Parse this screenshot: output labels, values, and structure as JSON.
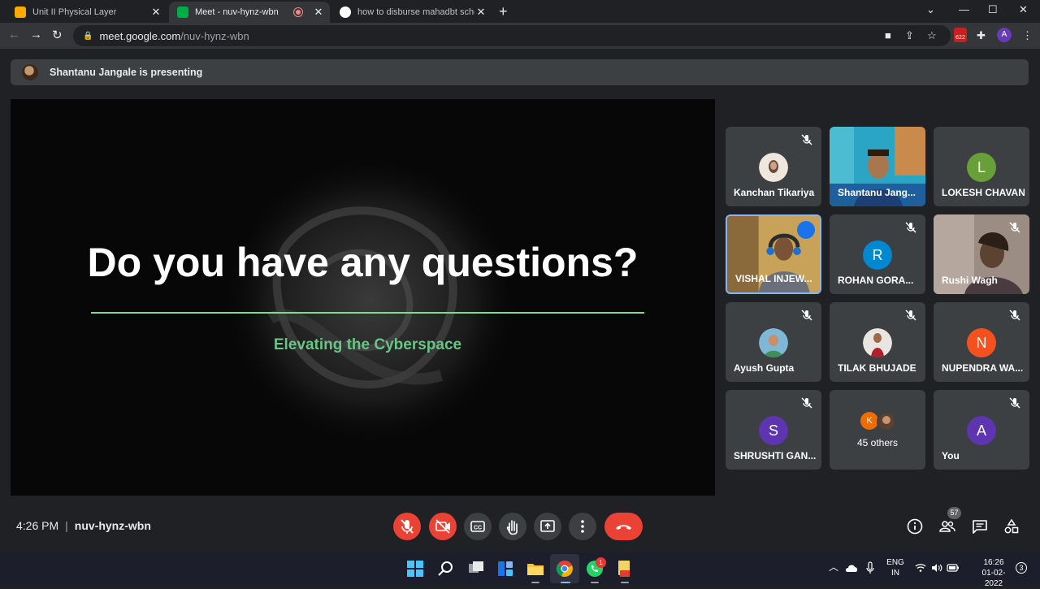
{
  "browser": {
    "tabs": [
      {
        "title": "Unit II Physical Layer",
        "active": false,
        "favicon_color": "#f9ab00"
      },
      {
        "title": "Meet - nuv-hynz-wbn",
        "active": true,
        "favicon_color": "#00ac47",
        "recording": true
      },
      {
        "title": "how to disburse mahadbt scholar",
        "active": false,
        "favicon_color": "#4285f4"
      }
    ],
    "url_host": "meet.google.com",
    "url_path": "/nuv-hynz-wbn",
    "extension_badge": "622",
    "profile_initial": "A"
  },
  "meet": {
    "presenting_banner": "Shantanu Jangale is presenting",
    "slide": {
      "title": "Do you have any questions?",
      "subtitle": "Elevating the Cyberspace",
      "accent_color": "#69c585"
    },
    "participants": [
      {
        "name": "Kanchan Tikariya",
        "muted": true,
        "display": "photo"
      },
      {
        "name": "Shantanu Jang...",
        "muted": false,
        "display": "video"
      },
      {
        "name": "LOKESH CHAVAN",
        "muted": false,
        "display": "initial",
        "initial": "L",
        "color": "#689f38"
      },
      {
        "name": "VISHAL INJEW...",
        "muted": false,
        "display": "video",
        "speaking": true
      },
      {
        "name": "ROHAN GORA...",
        "muted": true,
        "display": "initial",
        "initial": "R",
        "color": "#0288d1"
      },
      {
        "name": "Rushi Wagh",
        "muted": true,
        "display": "video"
      },
      {
        "name": "Ayush Gupta",
        "muted": true,
        "display": "photo"
      },
      {
        "name": "TILAK BHUJADE",
        "muted": true,
        "display": "photo"
      },
      {
        "name": "NUPENDRA WA...",
        "muted": true,
        "display": "initial",
        "initial": "N",
        "color": "#f4511e"
      },
      {
        "name": "SHRUSHTI GAN...",
        "muted": true,
        "display": "initial",
        "initial": "S",
        "color": "#5e35b1"
      },
      {
        "name": "45 others",
        "muted": false,
        "display": "group",
        "initial": "K"
      },
      {
        "name": "You",
        "muted": true,
        "display": "initial",
        "initial": "A",
        "color": "#5e35b1"
      }
    ],
    "meeting_time": "4:26 PM",
    "meeting_code": "nuv-hynz-wbn",
    "people_count": "57"
  },
  "taskbar": {
    "whatsapp_badge": "1",
    "language": "ENG",
    "region": "IN",
    "time": "16:26",
    "date": "01-02-2022",
    "notification_count": "3"
  }
}
